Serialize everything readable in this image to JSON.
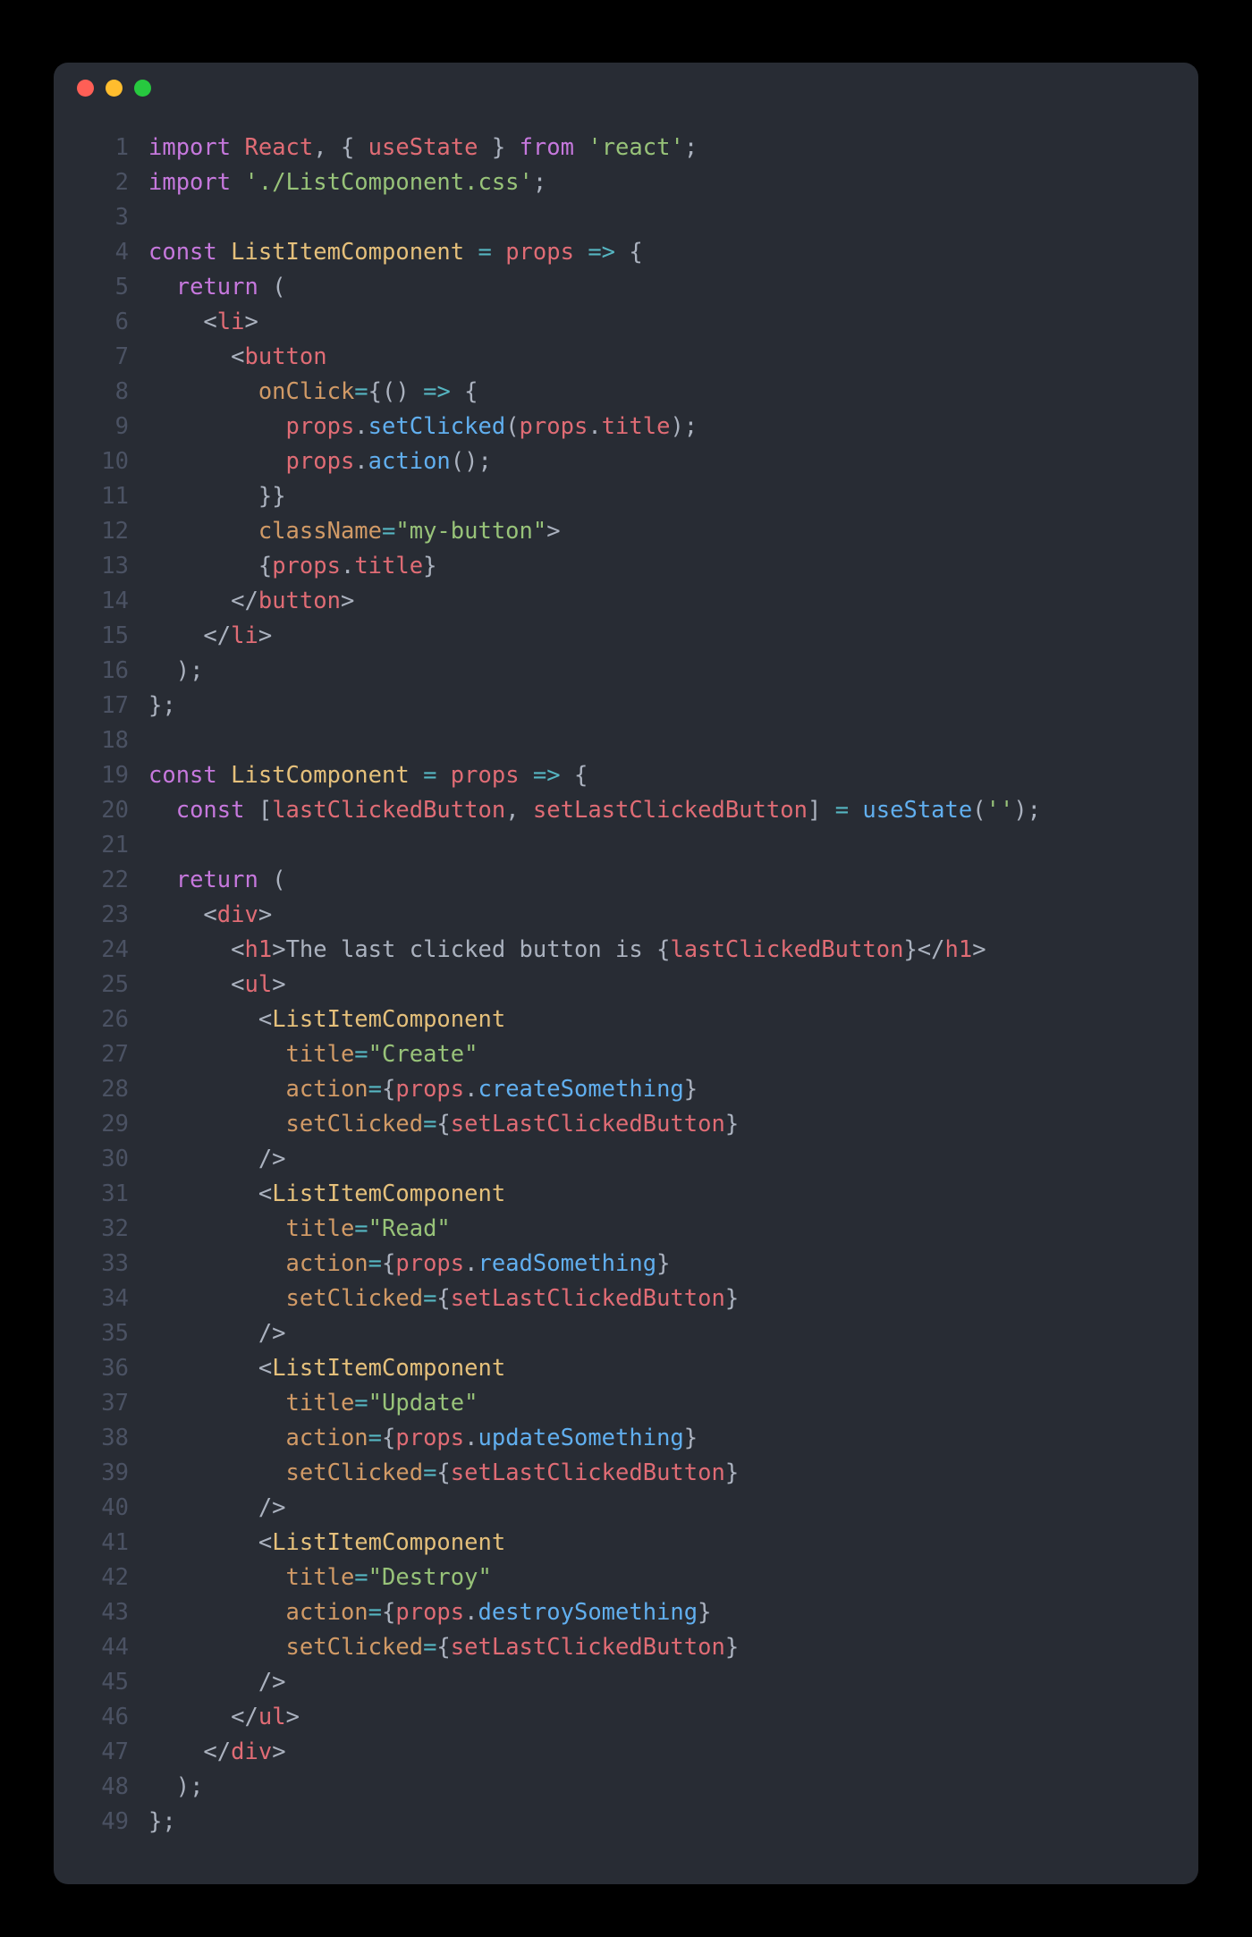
{
  "window": {
    "traffic_lights": [
      "close",
      "minimize",
      "maximize"
    ]
  },
  "code": {
    "language": "javascript-react",
    "lines": [
      {
        "n": 1,
        "tokens": [
          [
            "kw",
            "import"
          ],
          [
            "txt",
            " "
          ],
          [
            "var",
            "React"
          ],
          [
            "pun",
            ", { "
          ],
          [
            "var",
            "useState"
          ],
          [
            "pun",
            " } "
          ],
          [
            "kw",
            "from"
          ],
          [
            "txt",
            " "
          ],
          [
            "str",
            "'react'"
          ],
          [
            "pun",
            ";"
          ]
        ]
      },
      {
        "n": 2,
        "tokens": [
          [
            "kw",
            "import"
          ],
          [
            "txt",
            " "
          ],
          [
            "str",
            "'./ListComponent.css'"
          ],
          [
            "pun",
            ";"
          ]
        ]
      },
      {
        "n": 3,
        "tokens": []
      },
      {
        "n": 4,
        "tokens": [
          [
            "kw",
            "const"
          ],
          [
            "txt",
            " "
          ],
          [
            "id",
            "ListItemComponent"
          ],
          [
            "txt",
            " "
          ],
          [
            "op",
            "="
          ],
          [
            "txt",
            " "
          ],
          [
            "var",
            "props"
          ],
          [
            "txt",
            " "
          ],
          [
            "op",
            "=>"
          ],
          [
            "txt",
            " "
          ],
          [
            "pun",
            "{"
          ]
        ]
      },
      {
        "n": 5,
        "tokens": [
          [
            "txt",
            "  "
          ],
          [
            "kw",
            "return"
          ],
          [
            "txt",
            " "
          ],
          [
            "pun",
            "("
          ]
        ]
      },
      {
        "n": 6,
        "tokens": [
          [
            "txt",
            "    "
          ],
          [
            "pun",
            "<"
          ],
          [
            "var",
            "li"
          ],
          [
            "pun",
            ">"
          ]
        ]
      },
      {
        "n": 7,
        "tokens": [
          [
            "txt",
            "      "
          ],
          [
            "pun",
            "<"
          ],
          [
            "var",
            "button"
          ]
        ]
      },
      {
        "n": 8,
        "tokens": [
          [
            "txt",
            "        "
          ],
          [
            "attr",
            "onClick"
          ],
          [
            "op",
            "="
          ],
          [
            "pun",
            "{"
          ],
          [
            "pun",
            "("
          ],
          [
            "pun",
            ")"
          ],
          [
            "txt",
            " "
          ],
          [
            "op",
            "=>"
          ],
          [
            "txt",
            " "
          ],
          [
            "pun",
            "{"
          ]
        ]
      },
      {
        "n": 9,
        "tokens": [
          [
            "txt",
            "          "
          ],
          [
            "var",
            "props"
          ],
          [
            "pun",
            "."
          ],
          [
            "fn",
            "setClicked"
          ],
          [
            "pun",
            "("
          ],
          [
            "var",
            "props"
          ],
          [
            "pun",
            "."
          ],
          [
            "var",
            "title"
          ],
          [
            "pun",
            ")"
          ],
          [
            "pun",
            ";"
          ]
        ]
      },
      {
        "n": 10,
        "tokens": [
          [
            "txt",
            "          "
          ],
          [
            "var",
            "props"
          ],
          [
            "pun",
            "."
          ],
          [
            "fn",
            "action"
          ],
          [
            "pun",
            "("
          ],
          [
            "pun",
            ")"
          ],
          [
            "pun",
            ";"
          ]
        ]
      },
      {
        "n": 11,
        "tokens": [
          [
            "txt",
            "        "
          ],
          [
            "pun",
            "}"
          ],
          [
            "pun",
            "}"
          ]
        ]
      },
      {
        "n": 12,
        "tokens": [
          [
            "txt",
            "        "
          ],
          [
            "attr",
            "className"
          ],
          [
            "op",
            "="
          ],
          [
            "str",
            "\"my-button\""
          ],
          [
            "pun",
            ">"
          ]
        ]
      },
      {
        "n": 13,
        "tokens": [
          [
            "txt",
            "        "
          ],
          [
            "pun",
            "{"
          ],
          [
            "var",
            "props"
          ],
          [
            "pun",
            "."
          ],
          [
            "var",
            "title"
          ],
          [
            "pun",
            "}"
          ]
        ]
      },
      {
        "n": 14,
        "tokens": [
          [
            "txt",
            "      "
          ],
          [
            "pun",
            "</"
          ],
          [
            "var",
            "button"
          ],
          [
            "pun",
            ">"
          ]
        ]
      },
      {
        "n": 15,
        "tokens": [
          [
            "txt",
            "    "
          ],
          [
            "pun",
            "</"
          ],
          [
            "var",
            "li"
          ],
          [
            "pun",
            ">"
          ]
        ]
      },
      {
        "n": 16,
        "tokens": [
          [
            "txt",
            "  "
          ],
          [
            "pun",
            ")"
          ],
          [
            "pun",
            ";"
          ]
        ]
      },
      {
        "n": 17,
        "tokens": [
          [
            "pun",
            "}"
          ],
          [
            "pun",
            ";"
          ]
        ]
      },
      {
        "n": 18,
        "tokens": []
      },
      {
        "n": 19,
        "tokens": [
          [
            "kw",
            "const"
          ],
          [
            "txt",
            " "
          ],
          [
            "id",
            "ListComponent"
          ],
          [
            "txt",
            " "
          ],
          [
            "op",
            "="
          ],
          [
            "txt",
            " "
          ],
          [
            "var",
            "props"
          ],
          [
            "txt",
            " "
          ],
          [
            "op",
            "=>"
          ],
          [
            "txt",
            " "
          ],
          [
            "pun",
            "{"
          ]
        ]
      },
      {
        "n": 20,
        "tokens": [
          [
            "txt",
            "  "
          ],
          [
            "kw",
            "const"
          ],
          [
            "txt",
            " "
          ],
          [
            "pun",
            "["
          ],
          [
            "var",
            "lastClickedButton"
          ],
          [
            "pun",
            ", "
          ],
          [
            "var",
            "setLastClickedButton"
          ],
          [
            "pun",
            "]"
          ],
          [
            "txt",
            " "
          ],
          [
            "op",
            "="
          ],
          [
            "txt",
            " "
          ],
          [
            "fn",
            "useState"
          ],
          [
            "pun",
            "("
          ],
          [
            "str",
            "''"
          ],
          [
            "pun",
            ")"
          ],
          [
            "pun",
            ";"
          ]
        ]
      },
      {
        "n": 21,
        "tokens": []
      },
      {
        "n": 22,
        "tokens": [
          [
            "txt",
            "  "
          ],
          [
            "kw",
            "return"
          ],
          [
            "txt",
            " "
          ],
          [
            "pun",
            "("
          ]
        ]
      },
      {
        "n": 23,
        "tokens": [
          [
            "txt",
            "    "
          ],
          [
            "pun",
            "<"
          ],
          [
            "var",
            "div"
          ],
          [
            "pun",
            ">"
          ]
        ]
      },
      {
        "n": 24,
        "tokens": [
          [
            "txt",
            "      "
          ],
          [
            "pun",
            "<"
          ],
          [
            "var",
            "h1"
          ],
          [
            "pun",
            ">"
          ],
          [
            "txt",
            "The last clicked button is "
          ],
          [
            "pun",
            "{"
          ],
          [
            "var",
            "lastClickedButton"
          ],
          [
            "pun",
            "}"
          ],
          [
            "pun",
            "</"
          ],
          [
            "var",
            "h1"
          ],
          [
            "pun",
            ">"
          ]
        ]
      },
      {
        "n": 25,
        "tokens": [
          [
            "txt",
            "      "
          ],
          [
            "pun",
            "<"
          ],
          [
            "var",
            "ul"
          ],
          [
            "pun",
            ">"
          ]
        ]
      },
      {
        "n": 26,
        "tokens": [
          [
            "txt",
            "        "
          ],
          [
            "pun",
            "<"
          ],
          [
            "id",
            "ListItemComponent"
          ]
        ]
      },
      {
        "n": 27,
        "tokens": [
          [
            "txt",
            "          "
          ],
          [
            "attr",
            "title"
          ],
          [
            "op",
            "="
          ],
          [
            "str",
            "\"Create\""
          ]
        ]
      },
      {
        "n": 28,
        "tokens": [
          [
            "txt",
            "          "
          ],
          [
            "attr",
            "action"
          ],
          [
            "op",
            "="
          ],
          [
            "pun",
            "{"
          ],
          [
            "var",
            "props"
          ],
          [
            "pun",
            "."
          ],
          [
            "fn",
            "createSomething"
          ],
          [
            "pun",
            "}"
          ]
        ]
      },
      {
        "n": 29,
        "tokens": [
          [
            "txt",
            "          "
          ],
          [
            "attr",
            "setClicked"
          ],
          [
            "op",
            "="
          ],
          [
            "pun",
            "{"
          ],
          [
            "var",
            "setLastClickedButton"
          ],
          [
            "pun",
            "}"
          ]
        ]
      },
      {
        "n": 30,
        "tokens": [
          [
            "txt",
            "        "
          ],
          [
            "pun",
            "/>"
          ]
        ]
      },
      {
        "n": 31,
        "tokens": [
          [
            "txt",
            "        "
          ],
          [
            "pun",
            "<"
          ],
          [
            "id",
            "ListItemComponent"
          ]
        ]
      },
      {
        "n": 32,
        "tokens": [
          [
            "txt",
            "          "
          ],
          [
            "attr",
            "title"
          ],
          [
            "op",
            "="
          ],
          [
            "str",
            "\"Read\""
          ]
        ]
      },
      {
        "n": 33,
        "tokens": [
          [
            "txt",
            "          "
          ],
          [
            "attr",
            "action"
          ],
          [
            "op",
            "="
          ],
          [
            "pun",
            "{"
          ],
          [
            "var",
            "props"
          ],
          [
            "pun",
            "."
          ],
          [
            "fn",
            "readSomething"
          ],
          [
            "pun",
            "}"
          ]
        ]
      },
      {
        "n": 34,
        "tokens": [
          [
            "txt",
            "          "
          ],
          [
            "attr",
            "setClicked"
          ],
          [
            "op",
            "="
          ],
          [
            "pun",
            "{"
          ],
          [
            "var",
            "setLastClickedButton"
          ],
          [
            "pun",
            "}"
          ]
        ]
      },
      {
        "n": 35,
        "tokens": [
          [
            "txt",
            "        "
          ],
          [
            "pun",
            "/>"
          ]
        ]
      },
      {
        "n": 36,
        "tokens": [
          [
            "txt",
            "        "
          ],
          [
            "pun",
            "<"
          ],
          [
            "id",
            "ListItemComponent"
          ]
        ]
      },
      {
        "n": 37,
        "tokens": [
          [
            "txt",
            "          "
          ],
          [
            "attr",
            "title"
          ],
          [
            "op",
            "="
          ],
          [
            "str",
            "\"Update\""
          ]
        ]
      },
      {
        "n": 38,
        "tokens": [
          [
            "txt",
            "          "
          ],
          [
            "attr",
            "action"
          ],
          [
            "op",
            "="
          ],
          [
            "pun",
            "{"
          ],
          [
            "var",
            "props"
          ],
          [
            "pun",
            "."
          ],
          [
            "fn",
            "updateSomething"
          ],
          [
            "pun",
            "}"
          ]
        ]
      },
      {
        "n": 39,
        "tokens": [
          [
            "txt",
            "          "
          ],
          [
            "attr",
            "setClicked"
          ],
          [
            "op",
            "="
          ],
          [
            "pun",
            "{"
          ],
          [
            "var",
            "setLastClickedButton"
          ],
          [
            "pun",
            "}"
          ]
        ]
      },
      {
        "n": 40,
        "tokens": [
          [
            "txt",
            "        "
          ],
          [
            "pun",
            "/>"
          ]
        ]
      },
      {
        "n": 41,
        "tokens": [
          [
            "txt",
            "        "
          ],
          [
            "pun",
            "<"
          ],
          [
            "id",
            "ListItemComponent"
          ]
        ]
      },
      {
        "n": 42,
        "tokens": [
          [
            "txt",
            "          "
          ],
          [
            "attr",
            "title"
          ],
          [
            "op",
            "="
          ],
          [
            "str",
            "\"Destroy\""
          ]
        ]
      },
      {
        "n": 43,
        "tokens": [
          [
            "txt",
            "          "
          ],
          [
            "attr",
            "action"
          ],
          [
            "op",
            "="
          ],
          [
            "pun",
            "{"
          ],
          [
            "var",
            "props"
          ],
          [
            "pun",
            "."
          ],
          [
            "fn",
            "destroySomething"
          ],
          [
            "pun",
            "}"
          ]
        ]
      },
      {
        "n": 44,
        "tokens": [
          [
            "txt",
            "          "
          ],
          [
            "attr",
            "setClicked"
          ],
          [
            "op",
            "="
          ],
          [
            "pun",
            "{"
          ],
          [
            "var",
            "setLastClickedButton"
          ],
          [
            "pun",
            "}"
          ]
        ]
      },
      {
        "n": 45,
        "tokens": [
          [
            "txt",
            "        "
          ],
          [
            "pun",
            "/>"
          ]
        ]
      },
      {
        "n": 46,
        "tokens": [
          [
            "txt",
            "      "
          ],
          [
            "pun",
            "</"
          ],
          [
            "var",
            "ul"
          ],
          [
            "pun",
            ">"
          ]
        ]
      },
      {
        "n": 47,
        "tokens": [
          [
            "txt",
            "    "
          ],
          [
            "pun",
            "</"
          ],
          [
            "var",
            "div"
          ],
          [
            "pun",
            ">"
          ]
        ]
      },
      {
        "n": 48,
        "tokens": [
          [
            "txt",
            "  "
          ],
          [
            "pun",
            ")"
          ],
          [
            "pun",
            ";"
          ]
        ]
      },
      {
        "n": 49,
        "tokens": [
          [
            "pun",
            "}"
          ],
          [
            "pun",
            ";"
          ]
        ]
      }
    ]
  }
}
